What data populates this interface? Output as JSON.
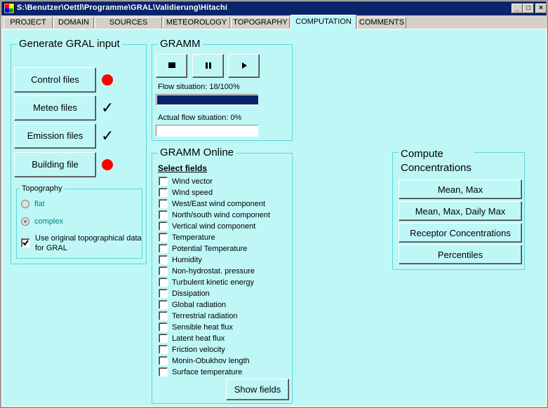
{
  "window": {
    "title": "S:\\Benutzer\\Oettl\\Programme\\GRAL\\Validierung\\Hitachi",
    "minimize": "_",
    "maximize": "□",
    "close": "×"
  },
  "tabs": [
    "PROJECT",
    "DOMAIN",
    "SOURCES",
    "METEOROLOGY",
    "TOPOGRAPHY",
    "COMPUTATION",
    "COMMENTS"
  ],
  "active_tab": "COMPUTATION",
  "generate": {
    "title": "Generate GRAL input",
    "buttons": [
      {
        "label": "Control files",
        "status": "red-dot-icon"
      },
      {
        "label": "Meteo files",
        "status": "checkmark-icon"
      },
      {
        "label": "Emission files",
        "status": "checkmark-icon"
      },
      {
        "label": "Building file",
        "status": "red-dot-icon"
      }
    ],
    "status_symbols": {
      "check": "✓"
    },
    "topography": {
      "title": "Topography",
      "flat": "flat",
      "complex": "complex",
      "use_original": "Use original topographical data for GRAL",
      "use_original_checked": true
    }
  },
  "gramm": {
    "title": "GRAMM",
    "stop_icon": "stop-icon",
    "pause_icon": "pause-icon",
    "play_icon": "play-icon",
    "flow_situation_label": "Flow situation: 18/100%",
    "flow_progress": 1.0,
    "actual_flow_label": "Actual flow situation: 0%",
    "actual_progress": 0.0
  },
  "gramm_online": {
    "title": "GRAMM Online",
    "select_fields": "Select fields",
    "fields": [
      "Wind vector",
      "Wind speed",
      "West/East wind component",
      "North/south wind component",
      "Vertical wind component",
      "Temperature",
      "Potential Temperature",
      "Humidity",
      "Non-hydrostat. pressure",
      "Turbulent kinetic energy",
      "Dissipation",
      "Global radiation",
      "Terrestrial radiation",
      "Sensible heat flux",
      "Latent heat flux",
      "Friction velocity",
      "Monin-Obukhov length",
      "Surface temperature"
    ],
    "show_fields": "Show fields"
  },
  "compute": {
    "title_line1": "Compute",
    "title_line2": "Concentrations",
    "buttons": [
      "Mean, Max",
      "Mean, Max, Daily Max",
      "Receptor Concentrations",
      "Percentiles"
    ]
  },
  "colors": {
    "panel": "#bff7f7",
    "title_bar": "#0a246a",
    "group_border": "#59d9d9",
    "progress": "#0a246a",
    "status_red": "#ff0000",
    "radio_label": "#008080"
  }
}
